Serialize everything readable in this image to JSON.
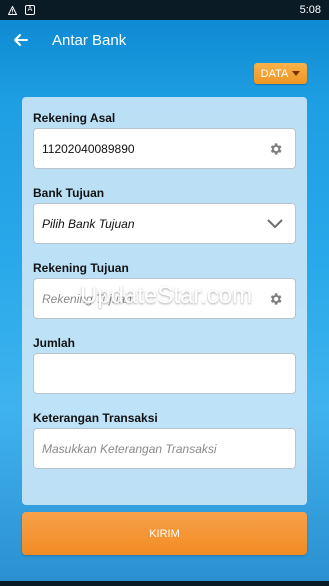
{
  "status_bar": {
    "time": "5:08"
  },
  "app_bar": {
    "title": "Antar Bank"
  },
  "data_button": {
    "label": "DATA"
  },
  "form": {
    "rekening_asal": {
      "label": "Rekening Asal",
      "value": "11202040089890"
    },
    "bank_tujuan": {
      "label": "Bank Tujuan",
      "value": "Pilih Bank Tujuan"
    },
    "rekening_tujuan": {
      "label": "Rekening Tujuan",
      "placeholder": "Rekening Tujuan"
    },
    "jumlah": {
      "label": "Jumlah",
      "value": ""
    },
    "keterangan": {
      "label": "Keterangan Transaksi",
      "placeholder": "Masukkan Keterangan Transaksi"
    }
  },
  "submit_button": {
    "label": "KIRIM"
  },
  "watermark": {
    "text": "UpdateStar.com"
  },
  "colors": {
    "accent": "#f28b23",
    "primary": "#1f9fe3",
    "card": "#d0e8f8"
  }
}
